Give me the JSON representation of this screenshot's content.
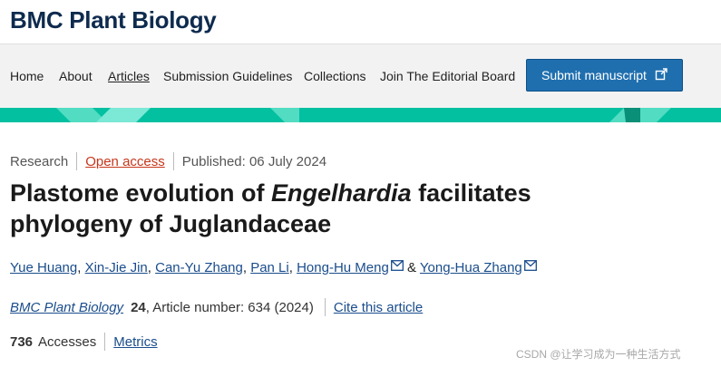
{
  "header": {
    "brand": "BMC Plant Biology"
  },
  "nav": {
    "items": [
      "Home",
      "About",
      "Articles",
      "Submission Guidelines",
      "Collections",
      "Join The Editorial Board"
    ],
    "submit_label": "Submit manuscript"
  },
  "article": {
    "type": "Research",
    "access": "Open access",
    "published": "Published: 06 July 2024",
    "title_part1": "Plastome evolution of ",
    "title_genus": "Engelhardia",
    "title_part2": " facilitates phylogeny of Juglandaceae",
    "authors": [
      "Yue Huang",
      "Xin-Jie Jin",
      "Can-Yu Zhang",
      "Pan Li",
      "Hong-Hu Meng",
      "Yong-Hua Zhang"
    ],
    "author_sep": ", ",
    "author_and": " & ",
    "journal": "BMC Plant Biology",
    "volume": "24",
    "article_number": ", Article number: 634 (2024)",
    "cite_label": "Cite this article",
    "accesses_count": "736",
    "accesses_label": "Accesses",
    "metrics_label": "Metrics"
  },
  "watermark": "CSDN @让学习成为一种生活方式",
  "colors": {
    "brand": "#0e2b4e",
    "accent_band": "#02c0a0",
    "button": "#1f6faf",
    "link": "#1a4d8c",
    "open_access": "#c7361b"
  }
}
